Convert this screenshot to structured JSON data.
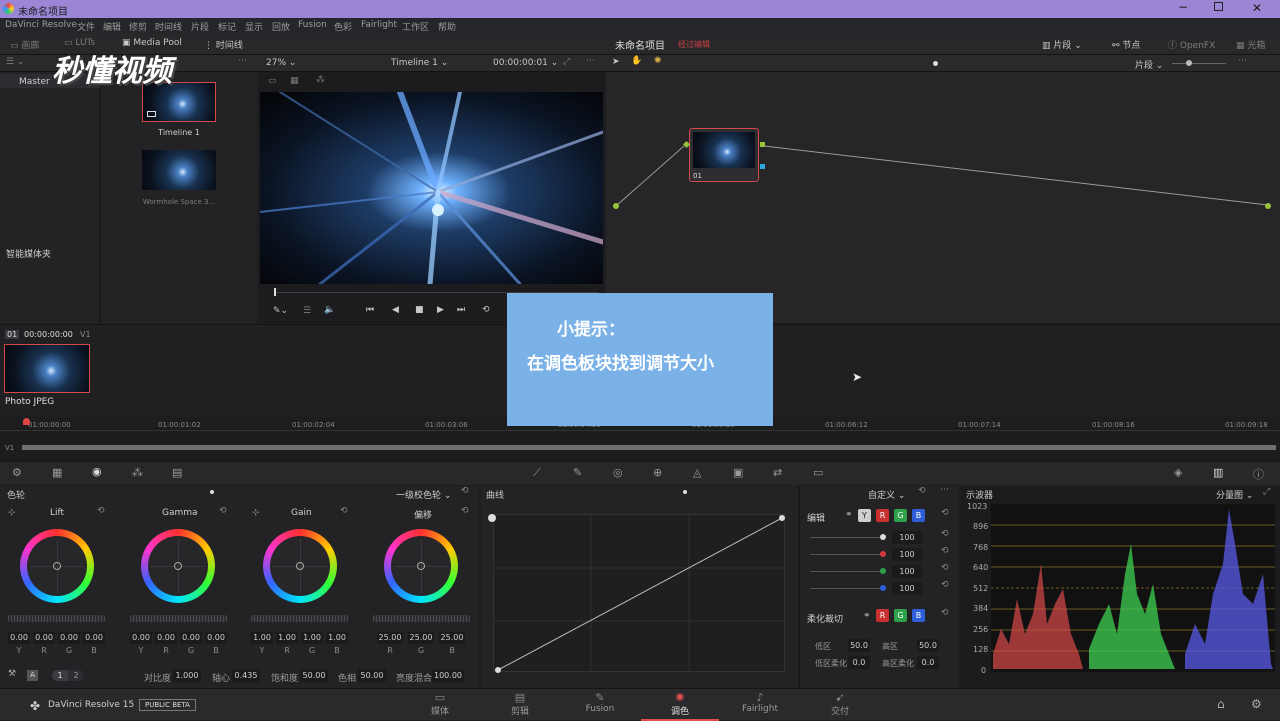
{
  "window": {
    "title": "未命名项目"
  },
  "menu": [
    "DaVinci Resolve",
    "文件",
    "编辑",
    "修剪",
    "时间线",
    "片段",
    "标记",
    "显示",
    "回放",
    "Fusion",
    "色彩",
    "Fairlight",
    "工作区",
    "帮助"
  ],
  "toolbar": {
    "gallery": "画廊",
    "luts": "LUTs",
    "media_pool": "Media Pool",
    "timeline": "时间线",
    "project_name": "未命名项目",
    "edited_status": "经过编辑",
    "clips": "片段",
    "nodes": "节点",
    "openfx": "OpenFX",
    "lightbox": "光箱"
  },
  "viewer_bar": {
    "zoom": "27%",
    "timeline_name": "Timeline 1",
    "timecode": "00:00:00:01",
    "mode": "片段"
  },
  "media_pool": {
    "bin": "Master",
    "smart_bins": "智能媒体夹",
    "items": [
      {
        "label": "Timeline 1"
      },
      {
        "label": "Wormhole Space 3..."
      }
    ]
  },
  "node": {
    "label": "01"
  },
  "clip_strip": {
    "index": "01",
    "timecode": "00:00:00:00",
    "track": "V1",
    "clip_label": "Photo JPEG"
  },
  "ruler": {
    "ticks": [
      "01:00:00:00",
      "01:00:01:02",
      "01:00:02:04",
      "01:00:03:06",
      "01:00:04:08",
      "01:00:05:10",
      "01:00:06:12",
      "01:00:07:14",
      "01:00:08:16",
      "01:00:09:18"
    ],
    "track": "V1"
  },
  "tip": {
    "line1": "小提示：",
    "line2": "在调色板块找到调节大小"
  },
  "color_wheels": {
    "title": "色轮",
    "mode": "一级校色轮",
    "wheels": [
      {
        "name": "Lift",
        "values": [
          "0.00",
          "0.00",
          "0.00",
          "0.00"
        ],
        "labels": [
          "Y",
          "R",
          "G",
          "B"
        ]
      },
      {
        "name": "Gamma",
        "values": [
          "0.00",
          "0.00",
          "0.00",
          "0.00"
        ],
        "labels": [
          "Y",
          "R",
          "G",
          "B"
        ]
      },
      {
        "name": "Gain",
        "values": [
          "1.00",
          "1.00",
          "1.00",
          "1.00"
        ],
        "labels": [
          "Y",
          "R",
          "G",
          "B"
        ]
      },
      {
        "name": "偏移",
        "values": [
          "25.00",
          "25.00",
          "25.00"
        ],
        "labels": [
          "R",
          "G",
          "B"
        ]
      }
    ],
    "pages": [
      "1",
      "2"
    ],
    "bottom": {
      "contrast_label": "对比度",
      "contrast": "1.000",
      "pivot_label": "轴心",
      "pivot": "0.435",
      "sat_label": "饱和度",
      "sat": "50.00",
      "hue_label": "色相",
      "hue": "50.00",
      "lum_label": "亮度混合",
      "lum": "100.00"
    }
  },
  "curves": {
    "title": "曲线",
    "mode": "自定义"
  },
  "curve_edit": {
    "title": "编辑",
    "channels": [
      "Y",
      "R",
      "G",
      "B"
    ],
    "values": [
      "100",
      "100",
      "100",
      "100"
    ],
    "soft_clip": "柔化裁切",
    "low_label": "低区",
    "low": "50.0",
    "high_label": "高区",
    "high": "50.0",
    "low_soft_label": "低区柔化",
    "low_soft": "0.0",
    "high_soft_label": "高区柔化",
    "high_soft": "0.0"
  },
  "scope": {
    "title": "示波器",
    "mode": "分量图",
    "scale": [
      "1023",
      "896",
      "768",
      "640",
      "512",
      "384",
      "256",
      "128",
      "0"
    ]
  },
  "pages": {
    "items": [
      "媒体",
      "剪辑",
      "Fusion",
      "调色",
      "Fairlight",
      "交付"
    ],
    "active": "调色"
  },
  "footer": {
    "app": "DaVinci Resolve 15",
    "badge": "PUBLIC BETA"
  },
  "watermark": "秒懂视频",
  "colors": {
    "accent": "#e05050",
    "title_bar": "#9b86d6",
    "tip_bg": "#7ab2e8",
    "node_border": "#d24a4a"
  }
}
